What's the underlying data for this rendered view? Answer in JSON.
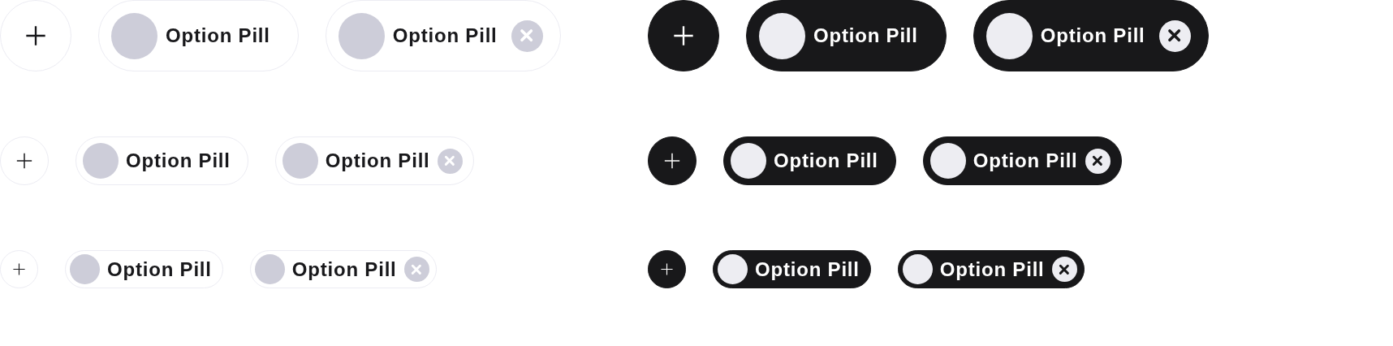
{
  "rows": [
    {
      "kind": "large",
      "groups": [
        {
          "dark": false,
          "items": [
            {
              "kind": "add"
            },
            {
              "kind": "pill",
              "label": "Option Pill"
            },
            {
              "kind": "removable",
              "label": "Option Pill"
            }
          ]
        },
        {
          "dark": true,
          "items": [
            {
              "kind": "add"
            },
            {
              "kind": "pill",
              "label": "Option Pill"
            },
            {
              "kind": "removable",
              "label": "Option Pill"
            }
          ]
        }
      ]
    },
    {
      "kind": "medium",
      "groups": [
        {
          "dark": false,
          "items": [
            {
              "kind": "add"
            },
            {
              "kind": "pill",
              "label": "Option Pill"
            },
            {
              "kind": "removable",
              "label": "Option Pill"
            }
          ]
        },
        {
          "dark": true,
          "items": [
            {
              "kind": "add"
            },
            {
              "kind": "pill",
              "label": "Option Pill"
            },
            {
              "kind": "removable",
              "label": "Option Pill"
            }
          ]
        }
      ]
    },
    {
      "kind": "small",
      "groups": [
        {
          "dark": false,
          "items": [
            {
              "kind": "add"
            },
            {
              "kind": "pill",
              "label": "Option Pill"
            },
            {
              "kind": "removable",
              "label": "Option Pill"
            }
          ]
        },
        {
          "dark": true,
          "items": [
            {
              "kind": "add"
            },
            {
              "kind": "pill",
              "label": "Option Pill"
            },
            {
              "kind": "removable",
              "label": "Option Pill"
            }
          ]
        }
      ]
    }
  ]
}
